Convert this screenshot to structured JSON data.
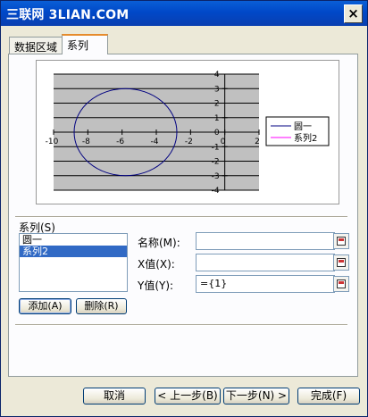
{
  "window": {
    "title": "三联网 3LIAN.COM",
    "close_label": "×"
  },
  "tabs": [
    {
      "label": "数据区域",
      "active": false
    },
    {
      "label": "系列",
      "active": true
    }
  ],
  "chart_data": {
    "type": "scatter",
    "title": "",
    "xlabel": "",
    "ylabel": "",
    "xlim": [
      -10,
      2
    ],
    "ylim": [
      -4,
      4
    ],
    "x_ticks": [
      -10,
      -8,
      -6,
      -4,
      -2,
      0,
      2
    ],
    "y_ticks": [
      4,
      3,
      2,
      1,
      0,
      -1,
      -2,
      -3,
      -4
    ],
    "plot_background": "#c0c0c0",
    "grid": true,
    "legend_position": "right",
    "series": [
      {
        "name": "圆一",
        "shape": "circle",
        "center": [
          -5.8,
          0
        ],
        "radius": 3,
        "color": "#000080"
      },
      {
        "name": "系列2",
        "values": [],
        "color": "#ff00ff"
      }
    ]
  },
  "series_panel": {
    "heading": "系列(S)",
    "items": [
      "圆一",
      "系列2"
    ],
    "selected_index": 1,
    "add_label": "添加(A)",
    "delete_label": "删除(R)"
  },
  "fields": {
    "name_label": "名称(M):",
    "name_value": "",
    "x_label": "X值(X):",
    "x_value": "",
    "y_label": "Y值(Y):",
    "y_value": "={1}"
  },
  "buttons": {
    "cancel": "取消",
    "back": "< 上一步(B)",
    "next": "下一步(N) >",
    "finish": "完成(F)"
  }
}
